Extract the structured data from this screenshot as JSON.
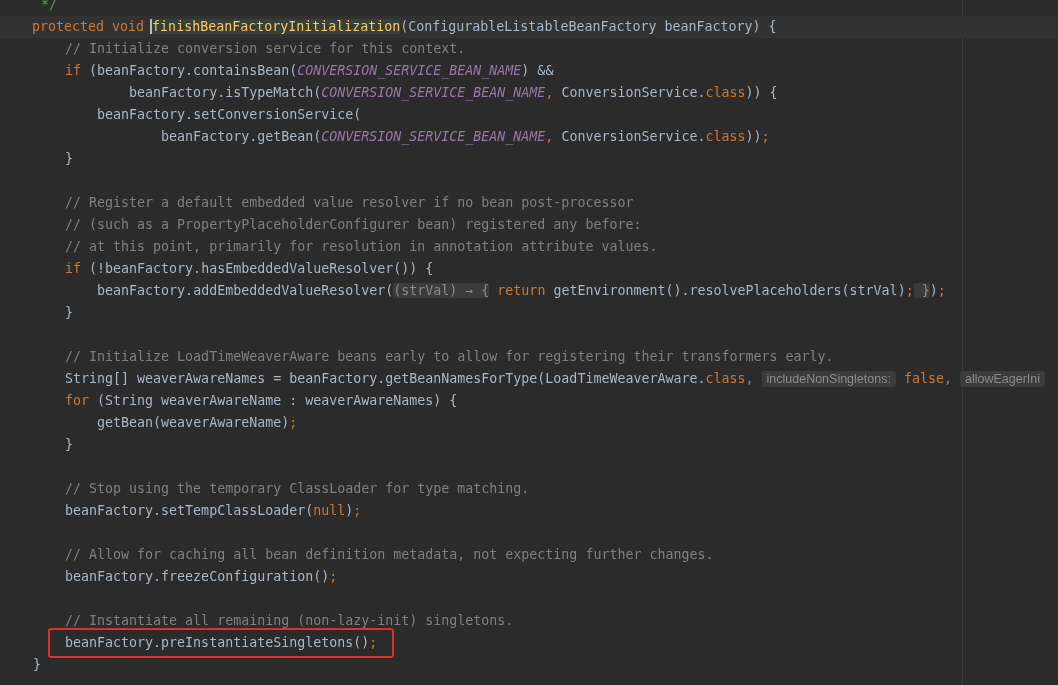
{
  "editor": {
    "lines": [
      {
        "kind": "code",
        "tokens": [
          {
            "kind": "doc",
            "text": "     */"
          }
        ]
      },
      {
        "kind": "code",
        "current": true,
        "outlined": false,
        "tokens": [
          {
            "kind": "keyword",
            "text": "    protected void "
          },
          {
            "kind": "usage",
            "text": "finishBeanFactoryInitialization"
          },
          {
            "kind": "plain",
            "text": "(ConfigurableListableBeanFactory beanFactory) {"
          }
        ]
      },
      {
        "kind": "code",
        "current": false,
        "outlined": false,
        "tokens": [
          {
            "kind": "comment",
            "text": "        // Initialize conversion service for this context."
          }
        ]
      },
      {
        "kind": "code",
        "current": false,
        "outlined": false,
        "tokens": [
          {
            "kind": "keyword",
            "text": "        if"
          },
          {
            "kind": "plain",
            "text": " (beanFactory.containsBean("
          },
          {
            "kind": "constant",
            "text": "CONVERSION_SERVICE_BEAN_NAME"
          },
          {
            "kind": "plain",
            "text": ") &&"
          }
        ]
      },
      {
        "kind": "code",
        "current": false,
        "outlined": false,
        "tokens": [
          {
            "kind": "plain",
            "text": "                beanFactory.isTypeMatch("
          },
          {
            "kind": "constant",
            "text": "CONVERSION_SERVICE_BEAN_NAME"
          },
          {
            "kind": "keyword",
            "text": ","
          },
          {
            "kind": "plain",
            "text": " ConversionService."
          },
          {
            "kind": "keyword",
            "text": "class"
          },
          {
            "kind": "plain",
            "text": ")) {"
          }
        ]
      },
      {
        "kind": "code",
        "current": false,
        "outlined": false,
        "tokens": [
          {
            "kind": "plain",
            "text": "            beanFactory.setConversionService("
          }
        ]
      },
      {
        "kind": "code",
        "current": false,
        "outlined": false,
        "tokens": [
          {
            "kind": "plain",
            "text": "                    beanFactory.getBean("
          },
          {
            "kind": "constant",
            "text": "CONVERSION_SERVICE_BEAN_NAME"
          },
          {
            "kind": "keyword",
            "text": ","
          },
          {
            "kind": "plain",
            "text": " ConversionService."
          },
          {
            "kind": "keyword",
            "text": "class"
          },
          {
            "kind": "plain",
            "text": "))"
          },
          {
            "kind": "keyword",
            "text": ";"
          }
        ]
      },
      {
        "kind": "code",
        "current": false,
        "outlined": false,
        "tokens": [
          {
            "kind": "plain",
            "text": "        }"
          }
        ]
      },
      {
        "kind": "blank"
      },
      {
        "kind": "code",
        "current": false,
        "outlined": false,
        "tokens": [
          {
            "kind": "comment",
            "text": "        // Register a default embedded value resolver if no bean post-processor"
          }
        ]
      },
      {
        "kind": "code",
        "current": false,
        "outlined": false,
        "tokens": [
          {
            "kind": "comment",
            "text": "        // (such as a PropertyPlaceholderConfigurer bean) registered any before:"
          }
        ]
      },
      {
        "kind": "code",
        "current": false,
        "outlined": false,
        "tokens": [
          {
            "kind": "comment",
            "text": "        // at this point, primarily for resolution in annotation attribute values."
          }
        ]
      },
      {
        "kind": "code",
        "current": false,
        "outlined": false,
        "tokens": [
          {
            "kind": "keyword",
            "text": "        if"
          },
          {
            "kind": "plain",
            "text": " (!beanFactory.hasEmbeddedValueResolver()) {"
          }
        ]
      },
      {
        "kind": "code",
        "current": false,
        "outlined": false,
        "tokens": [
          {
            "kind": "plain",
            "text": "            beanFactory.addEmbeddedValueResolver("
          },
          {
            "kind": "fold",
            "text": "(strVal) → {"
          },
          {
            "kind": "keyword",
            "text": " return"
          },
          {
            "kind": "plain",
            "text": " getEnvironment().resolvePlaceholders(strVal)"
          },
          {
            "kind": "keyword",
            "text": ";"
          },
          {
            "kind": "fold",
            "text": " }"
          },
          {
            "kind": "plain",
            "text": ")"
          },
          {
            "kind": "keyword",
            "text": ";"
          }
        ]
      },
      {
        "kind": "code",
        "current": false,
        "outlined": false,
        "tokens": [
          {
            "kind": "plain",
            "text": "        }"
          }
        ]
      },
      {
        "kind": "blank"
      },
      {
        "kind": "code",
        "current": false,
        "outlined": false,
        "tokens": [
          {
            "kind": "comment",
            "text": "        // Initialize LoadTimeWeaverAware beans early to allow for registering their transformers early."
          }
        ]
      },
      {
        "kind": "code",
        "current": false,
        "outlined": false,
        "tokens": [
          {
            "kind": "plain",
            "text": "        String[] weaverAwareNames = beanFactory.getBeanNamesForType(LoadTimeWeaverAware."
          },
          {
            "kind": "keyword",
            "text": "class, "
          },
          {
            "kind": "hint",
            "text": "includeNonSingletons:"
          },
          {
            "kind": "keyword",
            "text": " false, "
          },
          {
            "kind": "hint",
            "text": "allowEagerIni"
          }
        ]
      },
      {
        "kind": "code",
        "current": false,
        "outlined": false,
        "tokens": [
          {
            "kind": "keyword",
            "text": "        for"
          },
          {
            "kind": "plain",
            "text": " (String weaverAwareName : weaverAwareNames) {"
          }
        ]
      },
      {
        "kind": "code",
        "current": false,
        "outlined": false,
        "tokens": [
          {
            "kind": "plain",
            "text": "            getBean(weaverAwareName)"
          },
          {
            "kind": "keyword",
            "text": ";"
          }
        ]
      },
      {
        "kind": "code",
        "current": false,
        "outlined": false,
        "tokens": [
          {
            "kind": "plain",
            "text": "        }"
          }
        ]
      },
      {
        "kind": "blank"
      },
      {
        "kind": "code",
        "current": false,
        "outlined": false,
        "tokens": [
          {
            "kind": "comment",
            "text": "        // Stop using the temporary ClassLoader for type matching."
          }
        ]
      },
      {
        "kind": "code",
        "current": false,
        "outlined": false,
        "tokens": [
          {
            "kind": "plain",
            "text": "        beanFactory.setTempClassLoader("
          },
          {
            "kind": "keyword",
            "text": "null"
          },
          {
            "kind": "plain",
            "text": ")"
          },
          {
            "kind": "keyword",
            "text": ";"
          }
        ]
      },
      {
        "kind": "blank"
      },
      {
        "kind": "code",
        "current": false,
        "outlined": false,
        "tokens": [
          {
            "kind": "comment",
            "text": "        // Allow for caching all bean definition metadata, not expecting further changes."
          }
        ]
      },
      {
        "kind": "code",
        "current": false,
        "outlined": false,
        "tokens": [
          {
            "kind": "plain",
            "text": "        beanFactory.freezeConfiguration()"
          },
          {
            "kind": "keyword",
            "text": ";"
          }
        ]
      },
      {
        "kind": "blank"
      },
      {
        "kind": "code",
        "current": false,
        "outlined": false,
        "tokens": [
          {
            "kind": "comment",
            "text": "        // Instantiate all remaining (non-lazy-init) singletons."
          }
        ]
      },
      {
        "kind": "code",
        "current": false,
        "outlined": true,
        "tokens": [
          {
            "kind": "plain",
            "text": "        beanFactory.preInstantiateSingletons()"
          },
          {
            "kind": "keyword",
            "text": ";"
          }
        ]
      },
      {
        "kind": "code",
        "current": false,
        "outlined": false,
        "tokens": [
          {
            "kind": "plain",
            "text": "    }"
          }
        ]
      }
    ]
  }
}
